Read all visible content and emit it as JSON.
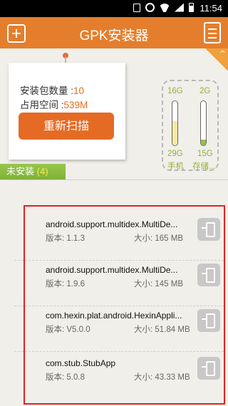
{
  "status_bar": {
    "time": "11:54"
  },
  "header": {
    "title": "GPK安装器"
  },
  "summary": {
    "package_count_label": "安装包数量 :",
    "package_count": "10",
    "space_label": "占用空间 :",
    "space_value": "539M",
    "rescan_label": "重新扫描"
  },
  "storage": {
    "phone": {
      "used": "16G",
      "total": "29G",
      "label": "手机",
      "fraction": 0.55
    },
    "sd": {
      "used": "2G",
      "total": "15G",
      "label": "存储...",
      "fraction": 0.13
    },
    "fill_colors": {
      "phone": "#f6e9a3",
      "sd": "#93c24a"
    }
  },
  "section": {
    "label": "未安装",
    "count": "(4)"
  },
  "apps": [
    {
      "name": "android.support.multidex.MultiDe...",
      "version": "版本: 1.1.3",
      "size": "大小: 165 MB"
    },
    {
      "name": "android.support.multidex.MultiDe...",
      "version": "版本: 1.9.6",
      "size": "大小: 145 MB"
    },
    {
      "name": "com.hexin.plat.android.HexinAppli...",
      "version": "版本: V5.0.0",
      "size": "大小: 51.84 MB"
    },
    {
      "name": "com.stub.StubApp",
      "version": "版本: 5.0.8",
      "size": "大小: 43.33 MB"
    }
  ],
  "colors": {
    "accent": "#e57e2c",
    "section_green": "#96c64a",
    "highlight_red": "#e2211c"
  }
}
